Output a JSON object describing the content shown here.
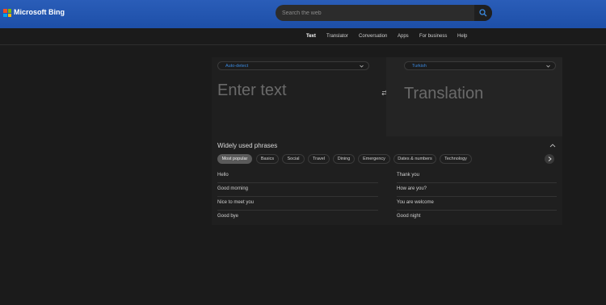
{
  "header": {
    "brand": "Microsoft Bing",
    "search_placeholder": "Search the web",
    "logo_colors": [
      "#f25022",
      "#7fba00",
      "#00a4ef",
      "#ffb900"
    ]
  },
  "nav": {
    "items": [
      {
        "label": "Text",
        "active": true
      },
      {
        "label": "Translator",
        "active": false
      },
      {
        "label": "Conversation",
        "active": false
      },
      {
        "label": "Apps",
        "active": false
      },
      {
        "label": "For business",
        "active": false
      },
      {
        "label": "Help",
        "active": false
      }
    ]
  },
  "translator": {
    "source_language": "Auto-detect",
    "target_language": "Turkish",
    "input_placeholder": "Enter text",
    "output_placeholder": "Translation"
  },
  "phrases": {
    "title": "Widely used phrases",
    "categories": [
      "Most popular",
      "Basics",
      "Social",
      "Travel",
      "Dining",
      "Emergency",
      "Dates & numbers",
      "Technology"
    ],
    "active_category": "Most popular",
    "left": [
      "Hello",
      "Good morning",
      "Nice to meet you",
      "Good bye"
    ],
    "right": [
      "Thank you",
      "How are you?",
      "You are welcome",
      "Good night"
    ]
  },
  "colors": {
    "header_bg": "#2a5db8",
    "accent": "#3b8ae0",
    "page_bg": "#1b1b1b"
  }
}
